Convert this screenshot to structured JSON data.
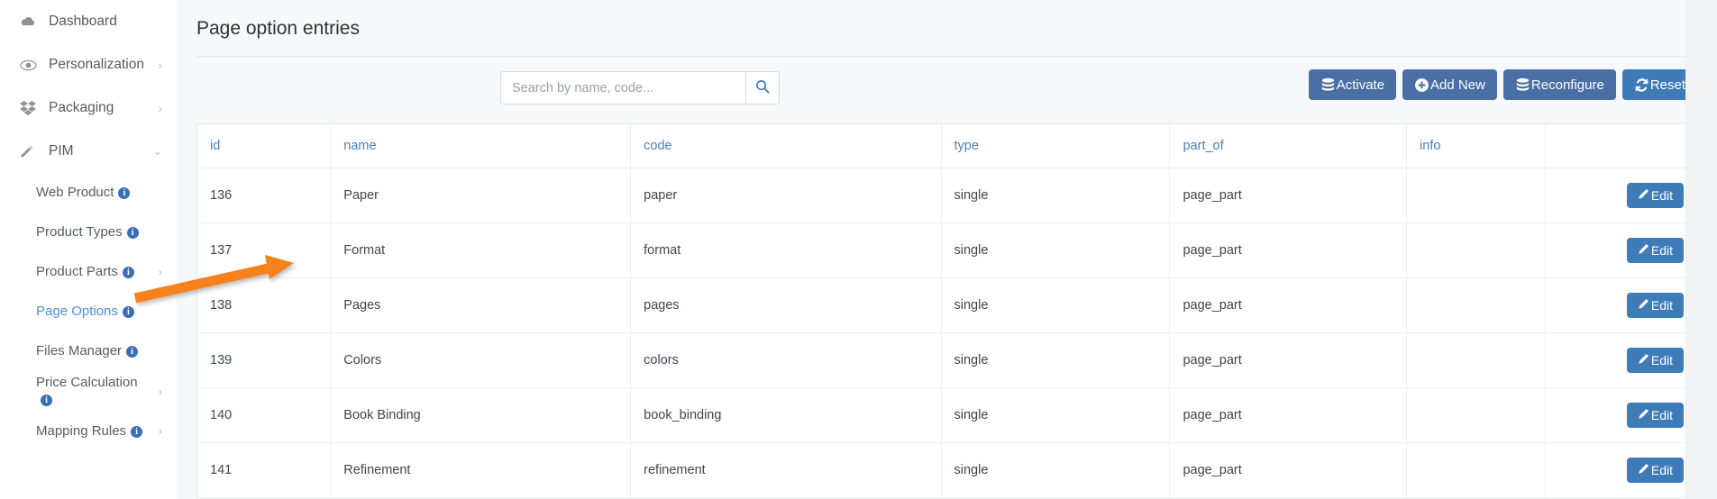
{
  "sidebar": {
    "top_items": [
      {
        "label": "Dashboard",
        "icon": "cloud-icon",
        "chevron": ""
      },
      {
        "label": "Personalization",
        "icon": "eye-icon",
        "chevron": "›"
      },
      {
        "label": "Packaging",
        "icon": "boxes-icon",
        "chevron": "›"
      },
      {
        "label": "PIM",
        "icon": "wand-icon",
        "chevron": "⌄"
      }
    ],
    "sub_items": [
      {
        "label": "Web Product",
        "info": "i",
        "chevron": "",
        "active": false
      },
      {
        "label": "Product Types",
        "info": "i",
        "chevron": "",
        "active": false
      },
      {
        "label": "Product Parts",
        "info": "i",
        "chevron": "›",
        "active": false
      },
      {
        "label": "Page Options",
        "info": "i",
        "chevron": "",
        "active": true
      },
      {
        "label": "Files Manager",
        "info": "i",
        "chevron": "",
        "active": false
      },
      {
        "label": "Price Calculation",
        "info": "i",
        "chevron": "›",
        "active": false
      },
      {
        "label": "Mapping Rules",
        "info": "i",
        "chevron": "›",
        "active": false
      }
    ]
  },
  "header": {
    "title": "Page option entries"
  },
  "search": {
    "placeholder": "Search by name, code...",
    "value": "",
    "button_icon": "search-icon"
  },
  "toolbar": {
    "buttons": [
      {
        "label": "Activate",
        "icon": "database-icon",
        "style": "primary"
      },
      {
        "label": "Add New",
        "icon": "plus-circle-icon",
        "style": "primary"
      },
      {
        "label": "Reconfigure",
        "icon": "database-icon",
        "style": "primary"
      },
      {
        "label": "Reset",
        "icon": "refresh-icon",
        "style": "accent"
      }
    ]
  },
  "table": {
    "columns": [
      "id",
      "name",
      "code",
      "type",
      "part_of",
      "info",
      ""
    ],
    "row_action_label": "Edit",
    "row_action_icon": "pencil-icon",
    "rows": [
      {
        "id": "136",
        "name": "Paper",
        "code": "paper",
        "type": "single",
        "part_of": "page_part",
        "info": ""
      },
      {
        "id": "137",
        "name": "Format",
        "code": "format",
        "type": "single",
        "part_of": "page_part",
        "info": ""
      },
      {
        "id": "138",
        "name": "Pages",
        "code": "pages",
        "type": "single",
        "part_of": "page_part",
        "info": ""
      },
      {
        "id": "139",
        "name": "Colors",
        "code": "colors",
        "type": "single",
        "part_of": "page_part",
        "info": ""
      },
      {
        "id": "140",
        "name": "Book Binding",
        "code": "book_binding",
        "type": "single",
        "part_of": "page_part",
        "info": ""
      },
      {
        "id": "141",
        "name": "Refinement",
        "code": "refinement",
        "type": "single",
        "part_of": "page_part",
        "info": ""
      }
    ]
  },
  "annotation": {
    "arrow_color": "#f5821f",
    "arrow_from": "Page Options",
    "arrow_to": "Pages"
  },
  "colors": {
    "primary_button": "#4a6fa5",
    "accent_button": "#3e7cb8",
    "link": "#4a7fc1",
    "active_nav": "#4a90e2",
    "page_bg": "#f7f8f9"
  }
}
